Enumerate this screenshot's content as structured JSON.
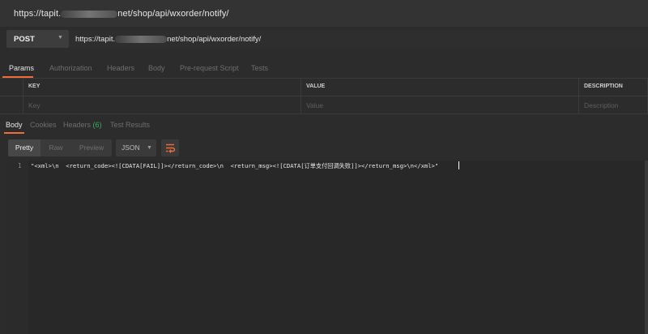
{
  "header": {
    "url_prefix": "https://tapit.",
    "url_suffix": "net/shop/api/wxorder/notify/"
  },
  "request": {
    "method": "POST",
    "url_prefix": "https://tapit.",
    "url_suffix": "net/shop/api/wxorder/notify/"
  },
  "request_tabs": [
    "Params",
    "Authorization",
    "Headers",
    "Body",
    "Pre-request Script",
    "Tests"
  ],
  "params_table": {
    "headers": [
      "KEY",
      "VALUE",
      "DESCRIPTION"
    ],
    "placeholders": [
      "Key",
      "Value",
      "Description"
    ]
  },
  "response_tabs": {
    "body": "Body",
    "cookies": "Cookies",
    "headers": "Headers",
    "headers_count": "(6)",
    "test_results": "Test Results"
  },
  "response_toolbar": {
    "pretty": "Pretty",
    "raw": "Raw",
    "preview": "Preview",
    "format": "JSON"
  },
  "response_body": {
    "line_number": "1",
    "line": "\"<xml>\\n  <return_code><![CDATA[FAIL]]></return_code>\\n  <return_msg><![CDATA[订单支付回调失败]]></return_msg>\\n</xml>\""
  },
  "colors": {
    "accent": "#f26b3a",
    "badge_green": "#3fae63",
    "background": "#2c2c2c"
  },
  "icons": {
    "method_dropdown": "caret-down-icon",
    "format_dropdown": "caret-down-icon",
    "wrap": "wrap-lines-icon"
  }
}
